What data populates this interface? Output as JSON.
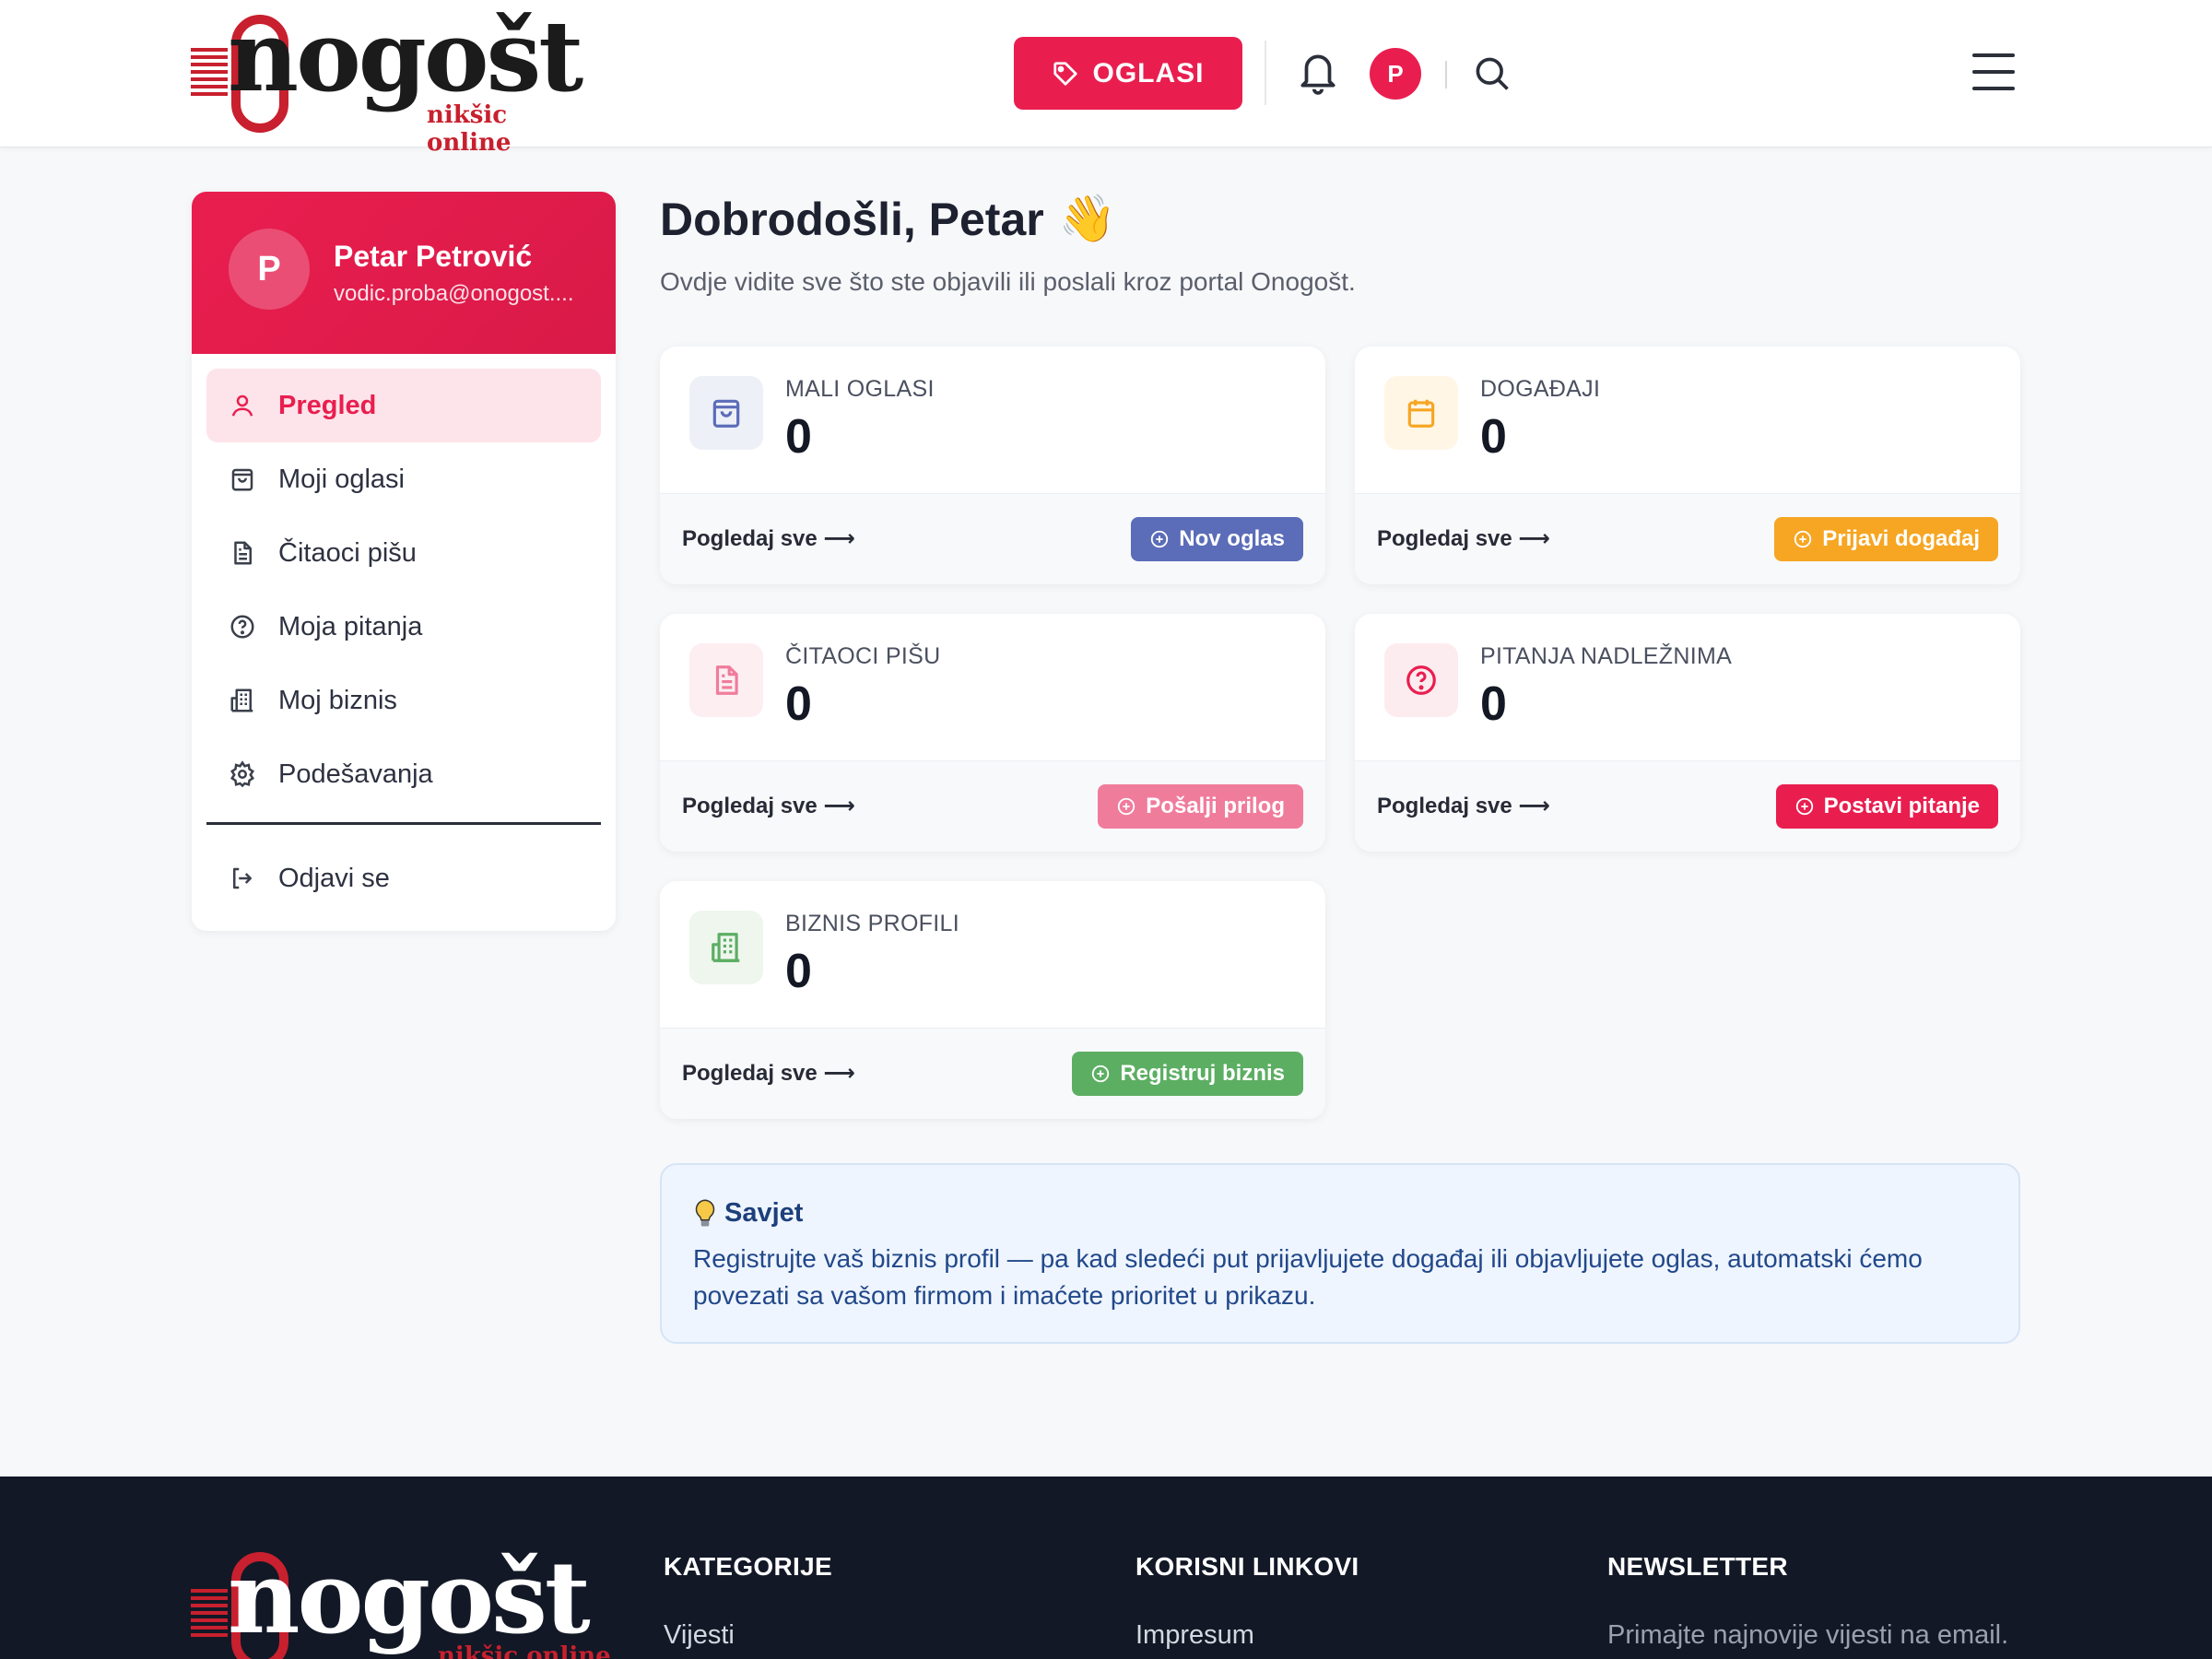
{
  "header": {
    "logo_word": "nogošt",
    "logo_sub": "nikšic online",
    "oglasi_label": "OGLASI",
    "avatar_initial": "P"
  },
  "sidebar": {
    "avatar_initial": "P",
    "name": "Petar Petrović",
    "email": "vodic.proba@onogost....",
    "items": [
      {
        "label": "Pregled",
        "icon": "user-icon"
      },
      {
        "label": "Moji oglasi",
        "icon": "shopping-bag-icon"
      },
      {
        "label": "Čitaoci pišu",
        "icon": "document-icon"
      },
      {
        "label": "Moja pitanja",
        "icon": "question-circle-icon"
      },
      {
        "label": "Moj biznis",
        "icon": "building-icon"
      },
      {
        "label": "Podešavanja",
        "icon": "gear-icon"
      }
    ],
    "logout_label": "Odjavi se"
  },
  "main": {
    "welcome": "Dobrodošli, Petar",
    "welcome_emoji": "👋",
    "subtitle": "Ovdje vidite sve što ste objavili ili poslali kroz portal Onogošt.",
    "cards": [
      {
        "label": "MALI OGLASI",
        "count": "0",
        "link": "Pogledaj sve",
        "button": "Nov oglas",
        "color": "#5b6cb8",
        "icon_bg": "#eef0f8"
      },
      {
        "label": "DOGAĐAJI",
        "count": "0",
        "link": "Pogledaj sve",
        "button": "Prijavi događaj",
        "color": "#f6a623",
        "icon_bg": "#fff6e6"
      },
      {
        "label": "ČITAOCI PIŠU",
        "count": "0",
        "link": "Pogledaj sve",
        "button": "Pošalji prilog",
        "color": "#f07c9c",
        "icon_bg": "#fdeef2"
      },
      {
        "label": "PITANJA NADLEŽNIMA",
        "count": "0",
        "link": "Pogledaj sve",
        "button": "Postavi pitanje",
        "color": "#e91e4f",
        "icon_bg": "#fdecef"
      },
      {
        "label": "BIZNIS PROFILI",
        "count": "0",
        "link": "Pogledaj sve",
        "button": "Registruj biznis",
        "color": "#5cae63",
        "icon_bg": "#eef6ee"
      }
    ],
    "tip": {
      "title": "Savjet",
      "text": "Registrujte vaš biznis profil — pa kad sledeći put prijavljujete događaj ili objavljujete oglas, automatski ćemo povezati sa vašom firmom i imaćete prioritet u prikazu."
    }
  },
  "footer": {
    "logo_word": "nogošt",
    "logo_sub": "nikšic online",
    "columns": [
      {
        "title": "KATEGORIJE",
        "first_item": "Vijesti"
      },
      {
        "title": "KORISNI LINKOVI",
        "first_item": "Impresum"
      },
      {
        "title": "NEWSLETTER",
        "first_item": "Primajte najnovije vijesti na email."
      }
    ]
  }
}
